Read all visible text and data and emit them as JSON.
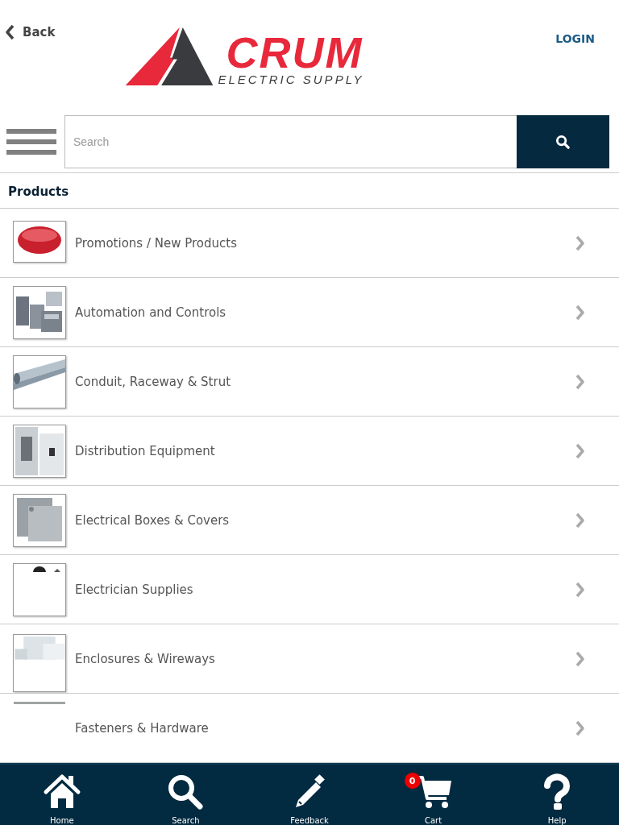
{
  "header": {
    "back": "Back",
    "logo": {
      "name": "CRUM",
      "tagline": "ELECTRIC SUPPLY"
    },
    "login": "LOGIN"
  },
  "search": {
    "placeholder": "Search"
  },
  "section_title": "Products",
  "categories": [
    {
      "label": "Promotions / New Products"
    },
    {
      "label": "Automation and Controls"
    },
    {
      "label": "Conduit, Raceway & Strut"
    },
    {
      "label": "Distribution Equipment"
    },
    {
      "label": "Electrical Boxes & Covers"
    },
    {
      "label": "Electrician Supplies"
    },
    {
      "label": "Enclosures & Wireways"
    },
    {
      "label": "Fasteners & Hardware"
    }
  ],
  "tab_bar": [
    {
      "kind": "home",
      "label": "Home"
    },
    {
      "kind": "search",
      "label": "Search"
    },
    {
      "kind": "feedback",
      "label": "Feedback"
    },
    {
      "kind": "cart",
      "label": "Cart",
      "badge": "0"
    },
    {
      "kind": "help",
      "label": "Help"
    }
  ]
}
